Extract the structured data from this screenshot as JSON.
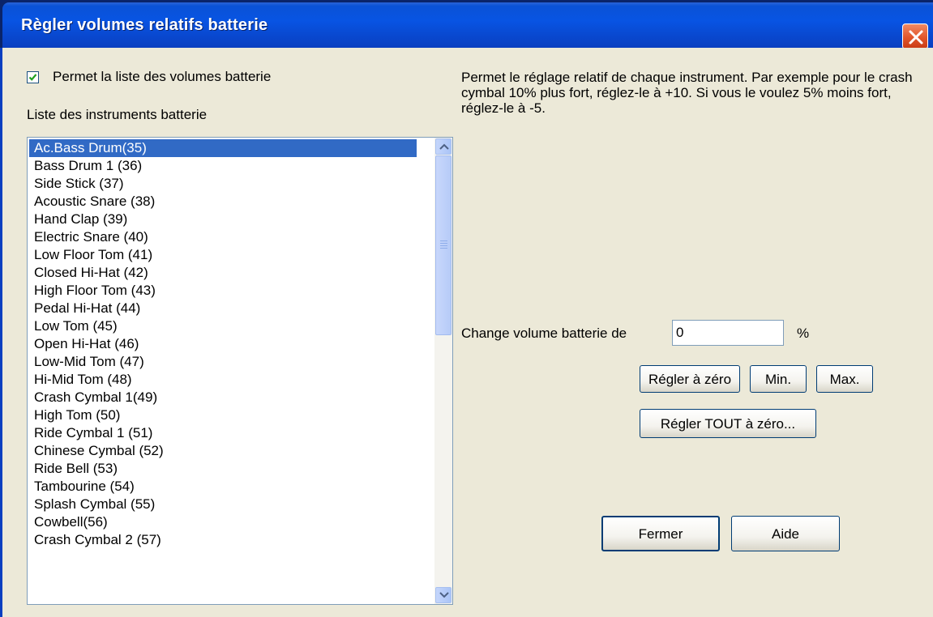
{
  "window": {
    "title": "Règler volumes relatifs batterie"
  },
  "checkbox": {
    "label": "Permet la liste des volumes batterie",
    "checked": true
  },
  "list": {
    "title": "Liste des instruments batterie",
    "selected_index": 0,
    "items": [
      "Ac.Bass Drum(35)",
      "Bass Drum 1 (36)",
      "Side Stick (37)",
      "Acoustic Snare (38)",
      "Hand Clap (39)",
      "Electric Snare (40)",
      "Low Floor Tom (41)",
      "Closed Hi-Hat (42)",
      "High Floor Tom (43)",
      "Pedal Hi-Hat (44)",
      "Low Tom  (45)",
      "Open Hi-Hat (46)",
      "Low-Mid Tom  (47)",
      "Hi-Mid Tom (48)",
      "Crash Cymbal 1(49)",
      "High Tom (50)",
      "Ride Cymbal 1 (51)",
      "Chinese Cymbal (52)",
      "Ride Bell (53)",
      "Tambourine (54)",
      "Splash Cymbal (55)",
      "Cowbell(56)",
      "Crash Cymbal 2 (57)"
    ]
  },
  "description": "Permet le réglage relatif de chaque instrument. Par exemple pour le crash cymbal 10% plus fort, réglez-le à +10. Si vous le voulez 5% moins fort, réglez-le à -5.",
  "volume": {
    "label": "Change volume batterie de",
    "value": "0",
    "unit": "%"
  },
  "buttons": {
    "reset_zero": "Régler à zéro",
    "min": "Min.",
    "max": "Max.",
    "reset_all": "Régler TOUT à zéro...",
    "close": "Fermer",
    "help": "Aide"
  },
  "colors": {
    "titlebar": "#0854e3",
    "selection": "#316ac5",
    "dialog_bg": "#ece9d8",
    "close_button": "#e2552a"
  }
}
